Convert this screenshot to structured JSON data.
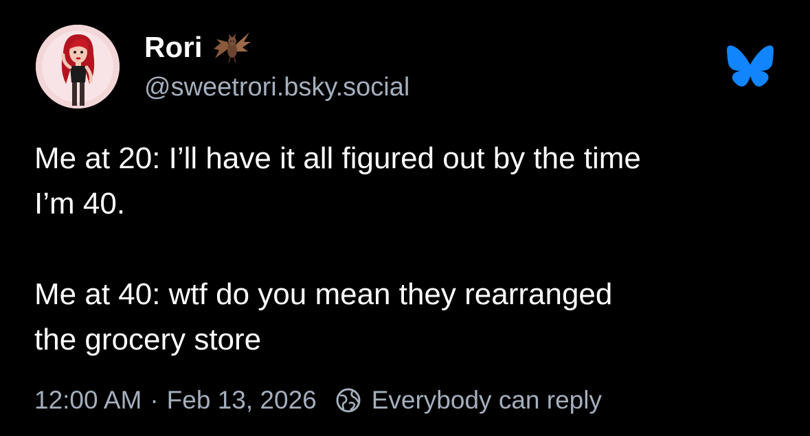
{
  "post": {
    "author": {
      "display_name": "Rori",
      "handle": "@sweetrori.bsky.social",
      "name_emoji_icon": "bat-icon",
      "avatar": "avatar-illustration"
    },
    "platform_icon": "bluesky-butterfly-icon",
    "text_lines": [
      "Me at 20: I’ll have it all figured out by the time",
      "I’m 40.",
      "Me at 40: wtf do you mean they rearranged",
      "the grocery store"
    ],
    "timestamp": "12:00 AM",
    "separator": "·",
    "date": "Feb 13, 2026",
    "reply_setting_icon": "globe-icon",
    "reply_setting": "Everybody can reply"
  },
  "colors": {
    "background": "#000000",
    "text": "#ffffff",
    "muted": "#a5afbd",
    "brand": "#1185fe"
  }
}
